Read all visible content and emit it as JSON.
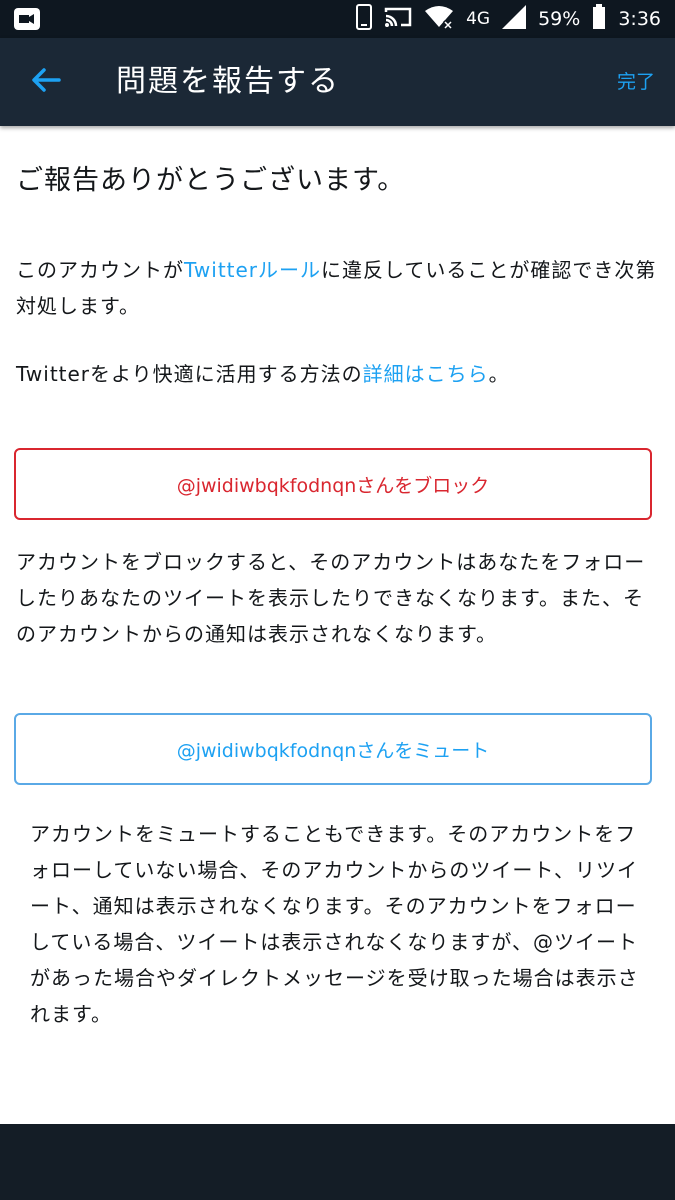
{
  "status_bar": {
    "network": "4G",
    "battery": "59%",
    "time": "3:36",
    "icons": [
      "video-app-icon",
      "phone-icon",
      "cast-icon",
      "wifi-icon",
      "signal-icon",
      "battery-icon"
    ]
  },
  "app_bar": {
    "title": "問題を報告する",
    "done_label": "完了",
    "back_icon": "arrow-left-icon",
    "accent": "#1da1f2"
  },
  "main": {
    "heading": "ご報告ありがとうございます。",
    "para1_before": "このアカウントが",
    "para1_link": "Twitterルール",
    "para1_after": "に違反していることが確認でき次第対処します。",
    "para2_before": "Twitterをより快適に活用する方法の",
    "para2_link": "詳細はこちら",
    "para2_after": "。",
    "block_button": "@jwidiwbqkfodnqnさんをブロック",
    "block_description": "アカウントをブロックすると、そのアカウントはあなたをフォローしたりあなたのツイートを表示したりできなくなります。また、そのアカウントからの通知は表示されなくなります。",
    "mute_button": "@jwidiwbqkfodnqnさんをミュート",
    "mute_description": "アカウントをミュートすることもできます。そのアカウントをフォローしていない場合、そのアカウントからのツイート、リツイート、通知は表示されなくなります。そのアカウントをフォローしている場合、ツイートは表示されなくなりますが、@ツイートがあった場合やダイレクトメッセージを受け取った場合は表示されます。"
  },
  "colors": {
    "block": "#d9262f",
    "mute_border": "#5aa9e6",
    "link": "#1da1f2",
    "app_bar": "#1b2836",
    "status_bar": "#0e1720"
  }
}
